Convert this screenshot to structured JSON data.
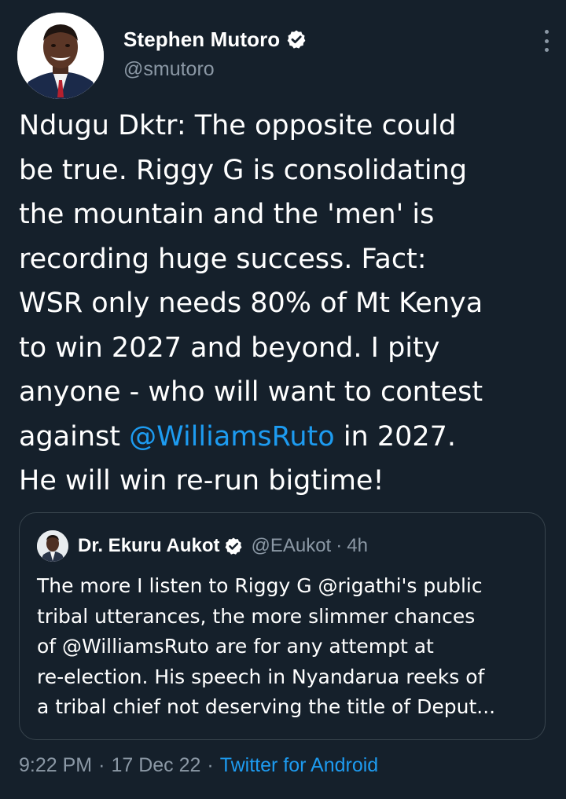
{
  "tweet": {
    "author": {
      "name": "Stephen Mutoro",
      "handle": "@smutoro",
      "verified": true,
      "avatar_icon": "profile-photo"
    },
    "body_lines": [
      {
        "text": "Ndugu Dktr: The opposite could"
      },
      {
        "text": "be true. Riggy G is consolidating"
      },
      {
        "text": "the mountain and the 'men' is"
      },
      {
        "text": "recording huge success. Fact:"
      },
      {
        "text": "WSR only needs 80% of Mt Kenya"
      },
      {
        "text": "to win 2027 and beyond. I pity"
      },
      {
        "text": "anyone - who will want to contest"
      },
      {
        "before": "against ",
        "mention": "@WilliamsRuto",
        "after": " in 2027."
      },
      {
        "text": "He will win re-run bigtime!"
      }
    ],
    "quoted": {
      "name": "Dr. Ekuru Aukot",
      "handle": "@EAukot",
      "separator": "·",
      "time": "4h",
      "verified": true,
      "lines": [
        "The more I listen to Riggy G @rigathi's public",
        "tribal utterances, the more slimmer chances",
        "of @WilliamsRuto are for any attempt at",
        "re-election. His speech in Nyandarua reeks of",
        "a tribal chief not deserving the title of Deput..."
      ]
    },
    "meta": {
      "time": "9:22 PM",
      "sep1": "·",
      "date": "17 Dec 22",
      "sep2": "·",
      "source": "Twitter for Android"
    }
  },
  "icons": {
    "verified": "verified-badge-icon",
    "more": "more-options-icon"
  },
  "colors": {
    "background": "#15202b",
    "text": "#ffffff",
    "secondary": "#8b98a5",
    "accent": "#1d9bf0",
    "border": "#38444d"
  }
}
